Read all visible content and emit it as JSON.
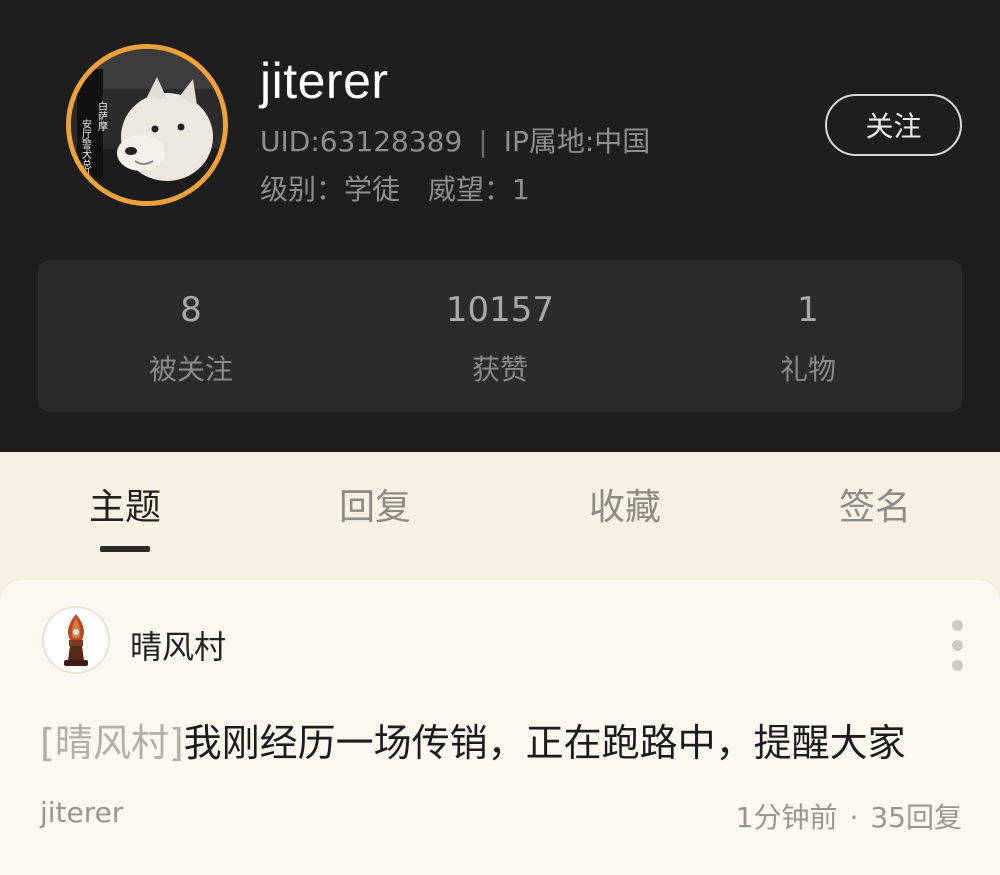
{
  "profile": {
    "username": "jiterer",
    "uid": "UID:63128389",
    "ip_location": "IP属地:中国",
    "level_label": "级别：学徒",
    "prestige_label": "威望：1",
    "follow_label": "关注",
    "avatar_icon": "samoyed-avatar-icon",
    "avatar_text": [
      "白萨摩",
      "安厅警犬总队党员"
    ]
  },
  "stats": [
    {
      "value": "8",
      "label": "被关注"
    },
    {
      "value": "10157",
      "label": "获赞"
    },
    {
      "value": "1",
      "label": "礼物"
    }
  ],
  "tabs": [
    {
      "label": "主题",
      "active": true
    },
    {
      "label": "回复",
      "active": false
    },
    {
      "label": "收藏",
      "active": false
    },
    {
      "label": "签名",
      "active": false
    }
  ],
  "post": {
    "forum_name": "晴风村",
    "forum_icon": "pen-nib-forum-icon",
    "tag": "[晴风村]",
    "title": "我刚经历一场传销，正在跑路中，提醒大家",
    "author": "jiterer",
    "time": "1分钟前",
    "replies": "35回复"
  },
  "colors": {
    "header_bg": "#1e1e1e",
    "stats_bg": "#2b2b2b",
    "avatar_ring": "#f0a23a",
    "page_bg": "#f7f1e3"
  }
}
